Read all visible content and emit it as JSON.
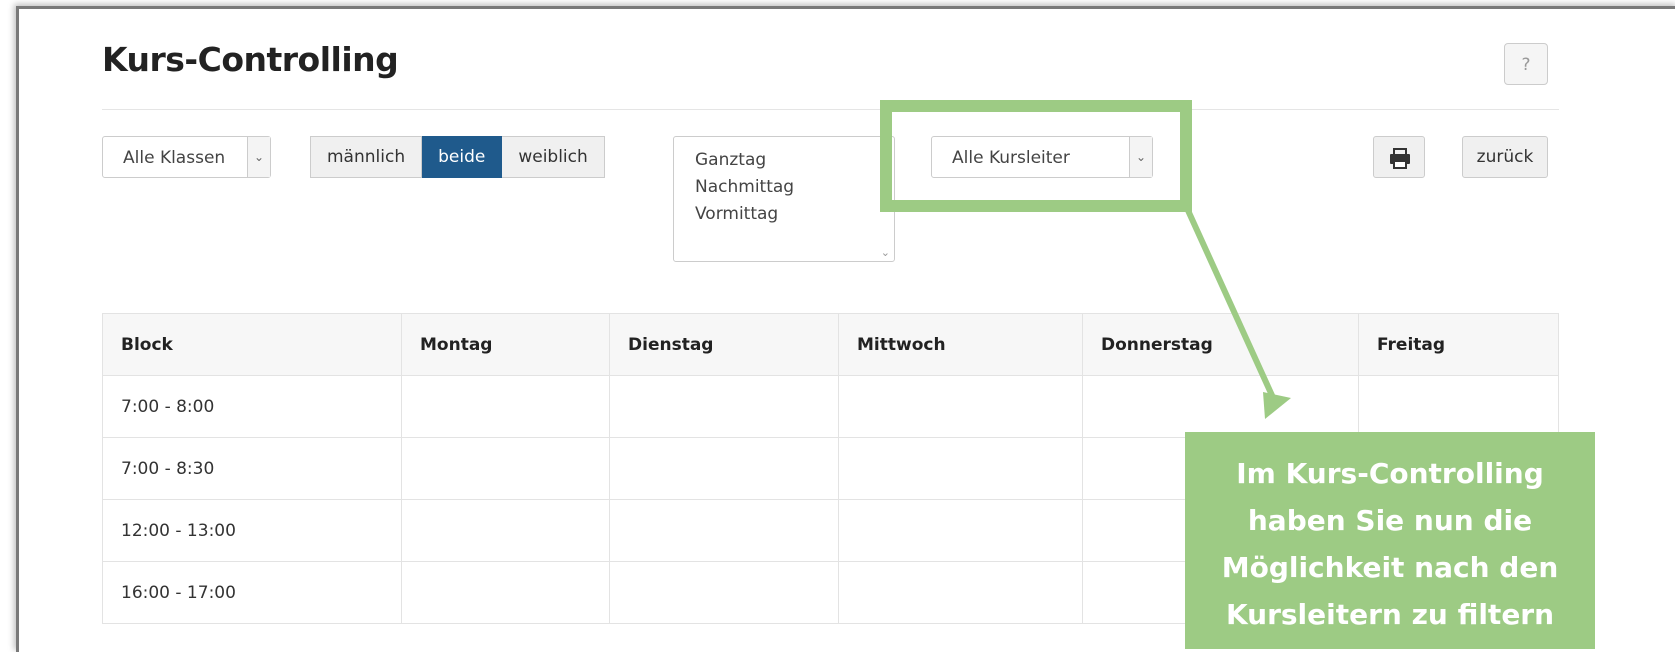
{
  "page": {
    "title": "Kurs-Controlling",
    "help_label": "?"
  },
  "filters": {
    "klassen": {
      "label": "Alle Klassen"
    },
    "gender": {
      "options": [
        "männlich",
        "beide",
        "weiblich"
      ],
      "active": "beide"
    },
    "tageszeit": {
      "options": [
        "Ganztag",
        "Nachmittag",
        "Vormittag"
      ]
    },
    "kursleiter": {
      "label": "Alle Kursleiter"
    }
  },
  "actions": {
    "print_icon": "printer-icon",
    "back_label": "zurück"
  },
  "table": {
    "headers": [
      "Block",
      "Montag",
      "Dienstag",
      "Mittwoch",
      "Donnerstag",
      "Freitag"
    ],
    "rows": [
      [
        "7:00 - 8:00",
        "",
        "",
        "",
        "",
        ""
      ],
      [
        "7:00 - 8:30",
        "",
        "",
        "",
        "",
        ""
      ],
      [
        "12:00 - 13:00",
        "",
        "",
        "",
        "",
        ""
      ],
      [
        "16:00 - 17:00",
        "",
        "",
        "",
        "",
        ""
      ]
    ]
  },
  "annotation": {
    "color": "#9dcb84",
    "lines": [
      "Im Kurs-Controlling",
      "haben Sie nun die",
      "Möglichkeit nach den",
      "Kursleitern zu filtern"
    ]
  },
  "colors": {
    "active_button": "#1f5a8c"
  }
}
